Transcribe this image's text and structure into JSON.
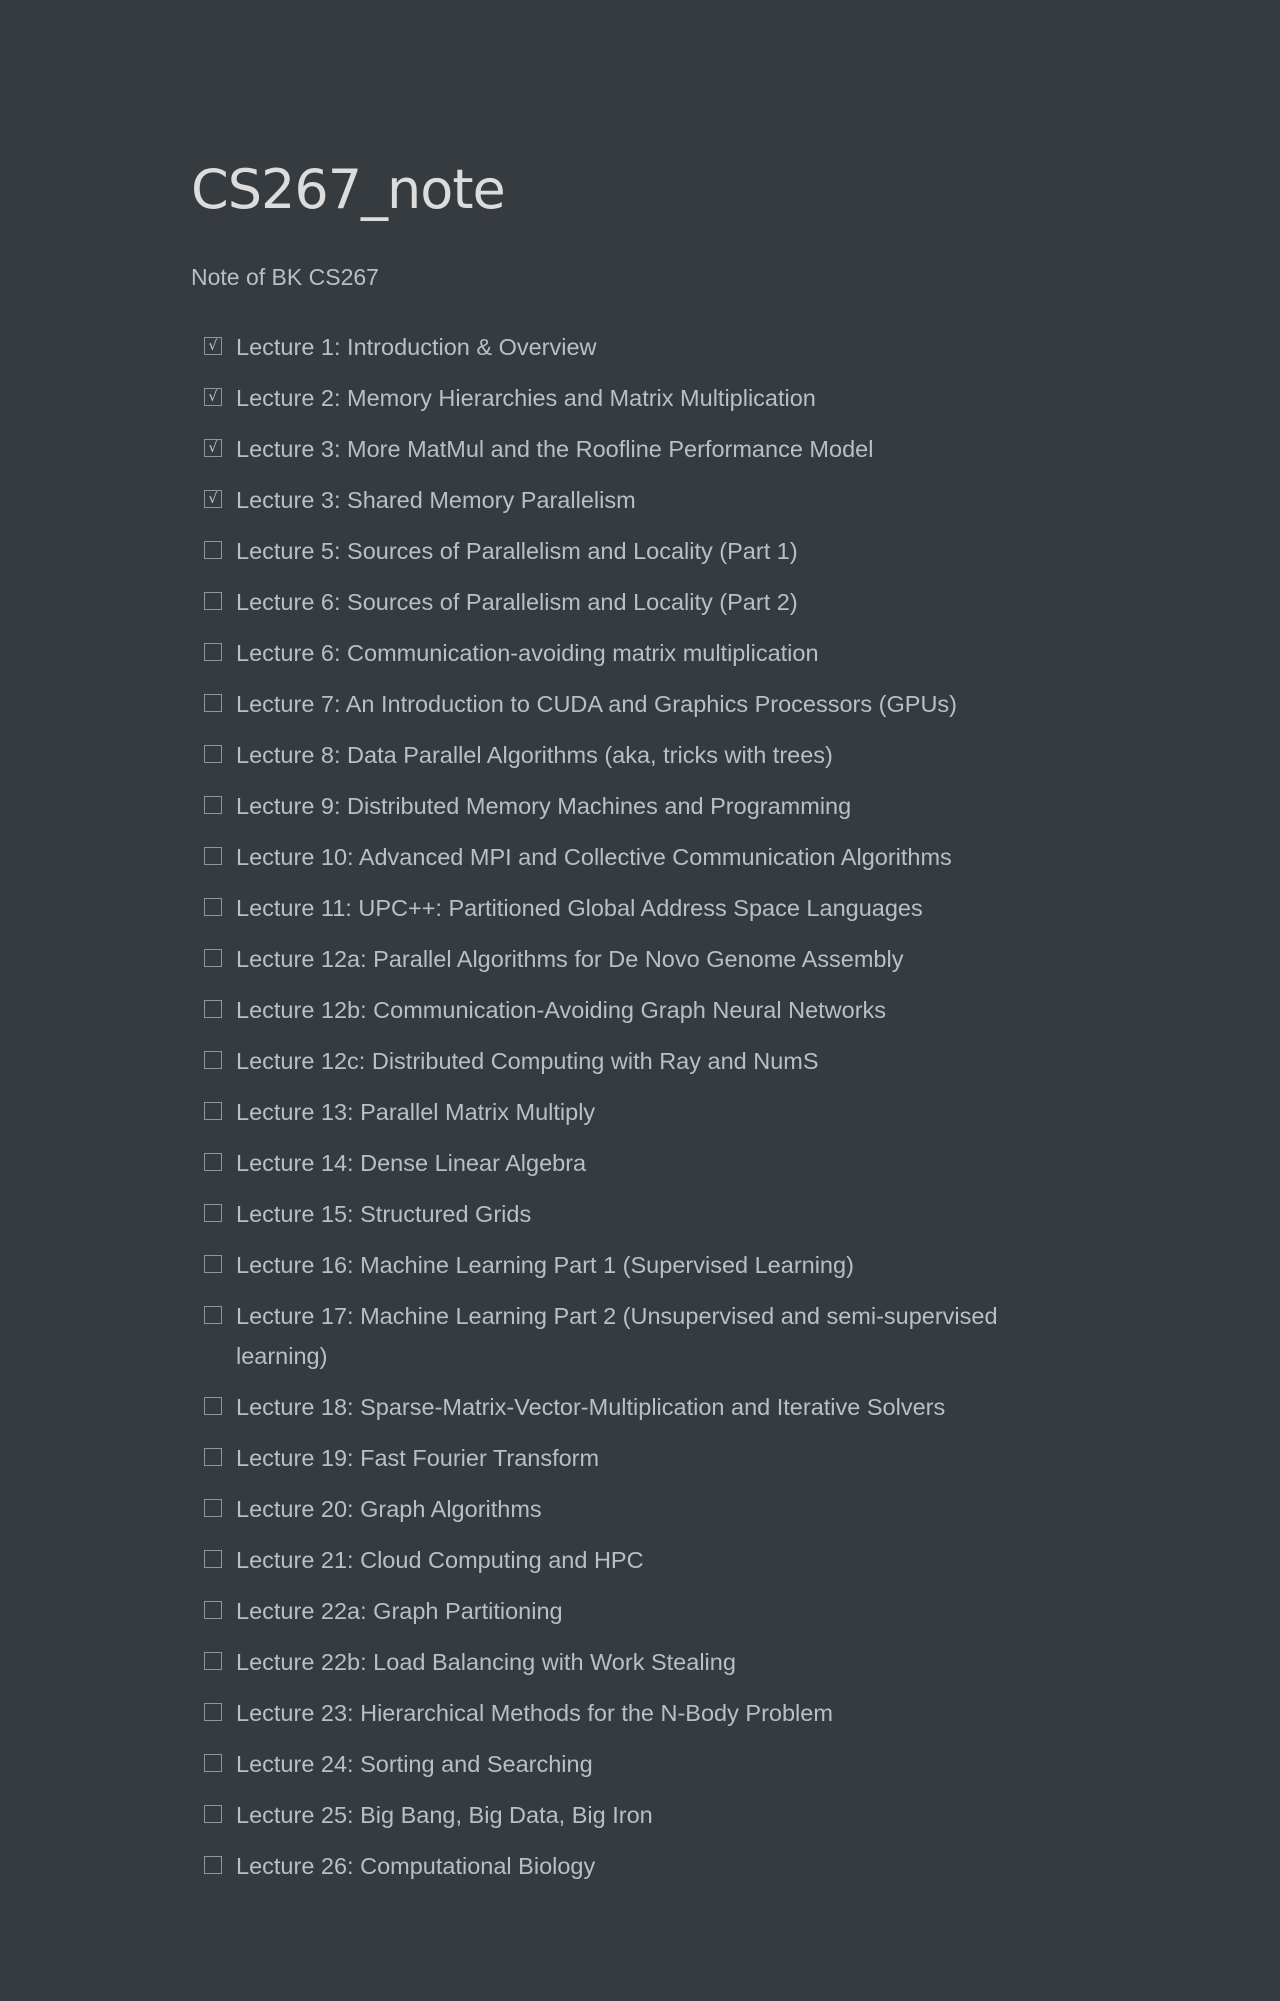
{
  "document": {
    "title": "CS267_note",
    "subtitle": "Note of BK CS267"
  },
  "checkmark_glyph": "√",
  "todos": [
    {
      "label": "Lecture 1: Introduction & Overview",
      "checked": true
    },
    {
      "label": "Lecture 2: Memory Hierarchies and Matrix Multiplication",
      "checked": true
    },
    {
      "label": "Lecture 3: More MatMul and the Roofline Performance Model",
      "checked": true
    },
    {
      "label": "Lecture 3: Shared Memory Parallelism",
      "checked": true
    },
    {
      "label": "Lecture 5: Sources of Parallelism and Locality (Part 1)",
      "checked": false
    },
    {
      "label": "Lecture 6: Sources of Parallelism and Locality (Part 2)",
      "checked": false
    },
    {
      "label": "Lecture 6: Communication-avoiding matrix multiplication",
      "checked": false
    },
    {
      "label": "Lecture 7: An Introduction to CUDA and Graphics Processors (GPUs)",
      "checked": false
    },
    {
      "label": "Lecture 8: Data Parallel Algorithms (aka, tricks with trees)",
      "checked": false
    },
    {
      "label": "Lecture 9: Distributed Memory Machines and Programming",
      "checked": false
    },
    {
      "label": "Lecture 10: Advanced MPI and Collective Communication Algorithms",
      "checked": false
    },
    {
      "label": "Lecture 11: UPC++: Partitioned Global Address Space Languages",
      "checked": false
    },
    {
      "label": "Lecture 12a: Parallel Algorithms for De Novo Genome Assembly",
      "checked": false
    },
    {
      "label": "Lecture 12b: Communication-Avoiding Graph Neural Networks",
      "checked": false
    },
    {
      "label": "Lecture 12c: Distributed Computing with Ray and NumS",
      "checked": false
    },
    {
      "label": "Lecture 13: Parallel Matrix Multiply",
      "checked": false
    },
    {
      "label": "Lecture 14: Dense Linear Algebra",
      "checked": false
    },
    {
      "label": "Lecture 15: Structured Grids",
      "checked": false
    },
    {
      "label": "Lecture 16: Machine Learning Part 1 (Supervised Learning)",
      "checked": false
    },
    {
      "label": "Lecture 17: Machine Learning Part 2 (Unsupervised and semi-supervised learning)",
      "checked": false
    },
    {
      "label": "Lecture 18: Sparse-Matrix-Vector-Multiplication and Iterative Solvers",
      "checked": false
    },
    {
      "label": "Lecture 19: Fast Fourier Transform",
      "checked": false
    },
    {
      "label": "Lecture 20: Graph Algorithms",
      "checked": false
    },
    {
      "label": "Lecture 21: Cloud Computing and HPC",
      "checked": false
    },
    {
      "label": "Lecture 22a: Graph Partitioning",
      "checked": false
    },
    {
      "label": "Lecture 22b: Load Balancing with Work Stealing",
      "checked": false
    },
    {
      "label": "Lecture 23: Hierarchical Methods for the N-Body Problem",
      "checked": false
    },
    {
      "label": "Lecture 24: Sorting and Searching",
      "checked": false
    },
    {
      "label": "Lecture 25: Big Bang, Big Data, Big Iron",
      "checked": false
    },
    {
      "label": "Lecture 26: Computational Biology",
      "checked": false
    }
  ]
}
